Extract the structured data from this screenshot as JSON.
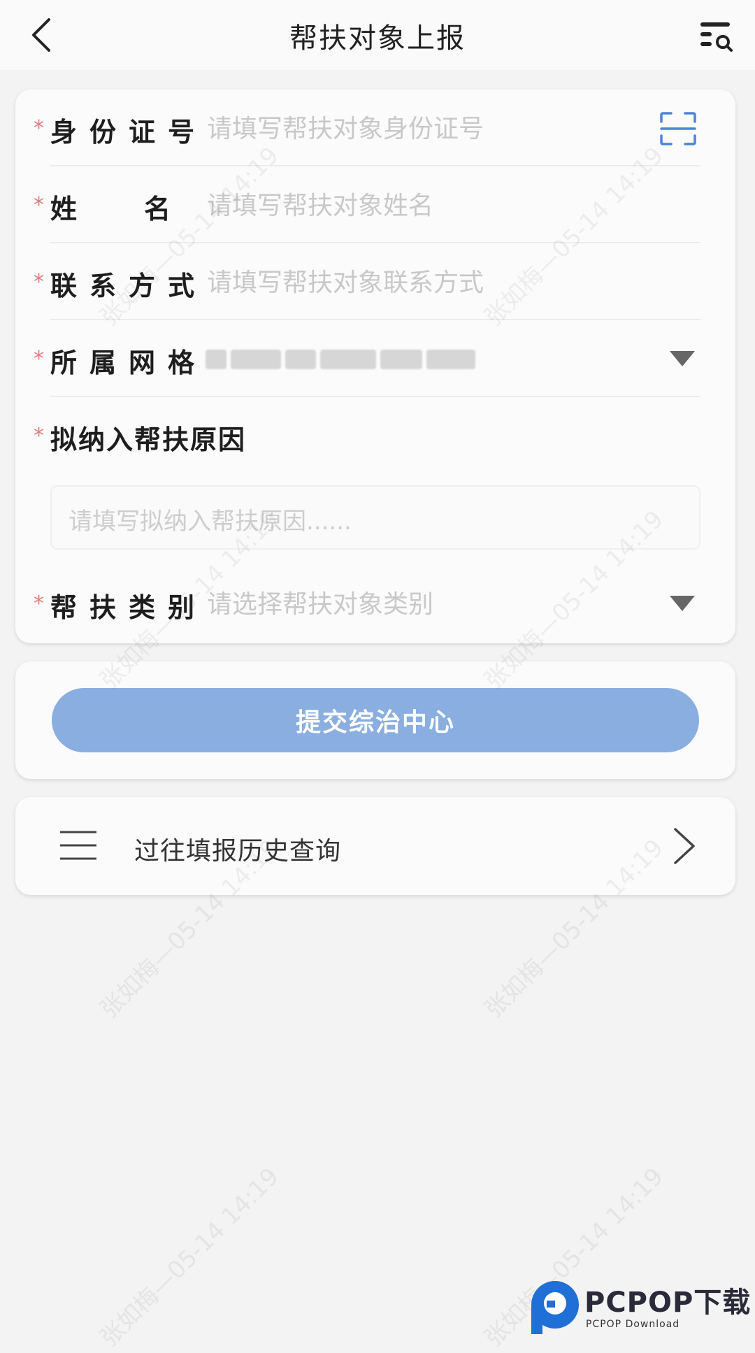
{
  "header": {
    "title": "帮扶对象上报"
  },
  "form": {
    "id_number": {
      "label": "身份证号",
      "placeholder": "请填写帮扶对象身份证号"
    },
    "name": {
      "label": "姓名",
      "placeholder": "请填写帮扶对象姓名"
    },
    "contact": {
      "label": "联系方式",
      "placeholder": "请填写帮扶对象联系方式"
    },
    "grid": {
      "label": "所属网格"
    },
    "reason": {
      "label": "拟纳入帮扶原因",
      "placeholder": "请填写拟纳入帮扶原因......"
    },
    "category": {
      "label": "帮扶类别",
      "placeholder": "请选择帮扶对象类别"
    }
  },
  "actions": {
    "submit_label": "提交综治中心"
  },
  "history": {
    "label": "过往填报历史查询"
  },
  "watermark": {
    "text": "张如梅—05-14 14:19"
  },
  "brand": {
    "name": "PCPOP下载",
    "sub": "PCPOP Download"
  },
  "colors": {
    "required_star": "#e07d7d",
    "submit_button": "#8aaee0",
    "scan_icon": "#4f83d8"
  },
  "icons": {
    "back": "chevron-left-icon",
    "search_list": "list-search-icon",
    "scan": "scan-icon",
    "dropdown": "caret-down-icon",
    "menu": "menu-icon",
    "forward": "chevron-right-icon"
  }
}
